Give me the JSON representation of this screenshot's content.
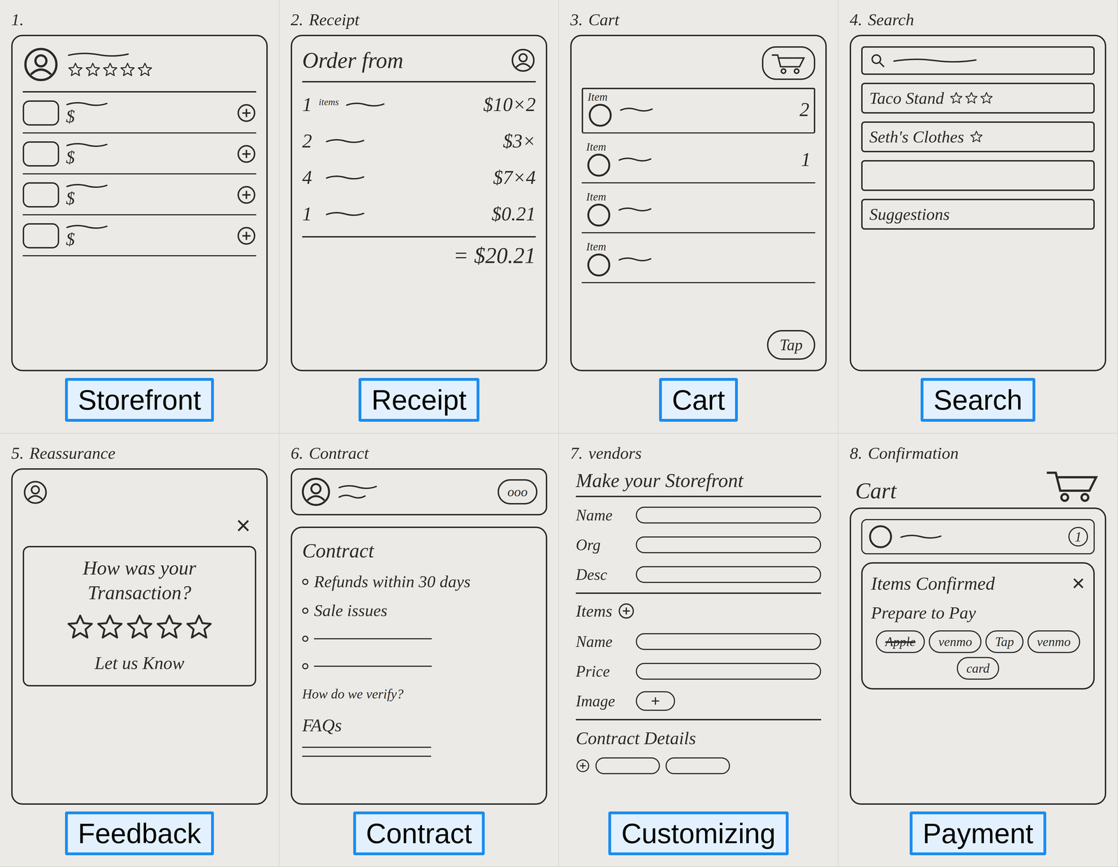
{
  "panels": [
    {
      "number": "1.",
      "title": "",
      "label": "Storefront",
      "kind": "storefront",
      "stars": 0,
      "stars_max": 5,
      "items": [
        {
          "price": "$"
        },
        {
          "price": "$"
        },
        {
          "price": "$"
        },
        {
          "price": "$"
        }
      ]
    },
    {
      "number": "2.",
      "title": "Receipt",
      "label": "Receipt",
      "kind": "receipt",
      "header": "Order from",
      "rows": [
        {
          "qty": "1",
          "note": "items",
          "price": "$10×2"
        },
        {
          "qty": "2",
          "note": "",
          "price": "$3×"
        },
        {
          "qty": "4",
          "note": "",
          "price": "$7×4"
        },
        {
          "qty": "1",
          "note": "",
          "price": "$0.21"
        }
      ],
      "total": "= $20.21"
    },
    {
      "number": "3.",
      "title": "Cart",
      "label": "Cart",
      "kind": "cart",
      "items": [
        {
          "name": "Item",
          "count": "2",
          "selected": true
        },
        {
          "name": "Item",
          "count": "1",
          "selected": false
        },
        {
          "name": "Item",
          "count": "",
          "selected": false
        },
        {
          "name": "Item",
          "count": "",
          "selected": false
        }
      ],
      "button": "Tap"
    },
    {
      "number": "4.",
      "title": "Search",
      "label": "Search",
      "kind": "search",
      "results": [
        {
          "name": "Taco Stand",
          "stars": 0,
          "stars_max": 3
        },
        {
          "name": "Seth's Clothes",
          "stars": 0,
          "stars_max": 1
        },
        {
          "name": "",
          "stars": 0,
          "stars_max": 0
        },
        {
          "name": "Suggestions",
          "stars": 0,
          "stars_max": 0
        }
      ]
    },
    {
      "number": "5.",
      "title": "Reassurance",
      "label": "Feedback",
      "kind": "feedback",
      "close": "×",
      "question": "How was your Transaction?",
      "stars": 0,
      "stars_max": 5,
      "footer": "Let us Know"
    },
    {
      "number": "6.",
      "title": "Contract",
      "label": "Contract",
      "kind": "contract",
      "menu": "ooo",
      "heading": "Contract",
      "bullets": [
        "Refunds within 30 days",
        "Sale issues",
        "",
        ""
      ],
      "verify": "How do we verify?",
      "faq": "FAQs"
    },
    {
      "number": "7.",
      "title": "vendors",
      "label": "Customizing",
      "kind": "vendor",
      "heading": "Make your Storefront",
      "fields": [
        "Name",
        "Org",
        "Desc"
      ],
      "items_label": "Items",
      "item_fields": [
        "Name",
        "Price"
      ],
      "image_label": "Image",
      "contract_label": "Contract Details"
    },
    {
      "number": "8.",
      "title": "Confirmation",
      "label": "Payment",
      "kind": "payment",
      "cart": "Cart",
      "count": "1",
      "modal_title": "Items Confirmed",
      "close": "×",
      "prompt": "Prepare to Pay",
      "options": [
        {
          "name": "Apple",
          "disabled": true
        },
        {
          "name": "venmo",
          "disabled": false
        },
        {
          "name": "Tap",
          "disabled": false
        },
        {
          "name": "venmo",
          "disabled": false
        },
        {
          "name": "card",
          "disabled": false
        }
      ]
    }
  ]
}
